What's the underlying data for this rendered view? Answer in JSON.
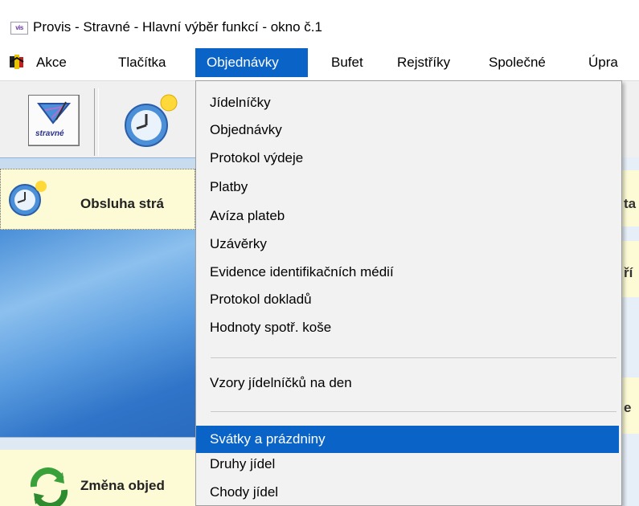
{
  "window": {
    "title": "Provis - Stravné - Hlavní výběr funkcí - okno č.1",
    "icon_text": "vis"
  },
  "menubar": {
    "items": [
      {
        "label": "Akce"
      },
      {
        "label": "Tlačítka"
      },
      {
        "label": "Objednávky"
      },
      {
        "label": "Bufet"
      },
      {
        "label": "Rejstříky"
      },
      {
        "label": "Společné"
      },
      {
        "label": "Úpra"
      }
    ],
    "active_index": 2
  },
  "toolbar": {
    "stravne_label": "stravné"
  },
  "panels": {
    "obsluha": "Obsluha strá",
    "zmena": "Změna objed",
    "right_a": "ta",
    "right_b": "ří",
    "right_c": "e"
  },
  "dropdown": {
    "items": [
      {
        "label": "Jídelníčky"
      },
      {
        "label": "Objednávky"
      },
      {
        "label": "Protokol výdeje"
      },
      {
        "label": "Platby"
      },
      {
        "label": "Avíza plateb"
      },
      {
        "label": "Uzávěrky"
      },
      {
        "label": "Evidence identifikačních médií"
      },
      {
        "label": "Protokol dokladů"
      },
      {
        "label": "Hodnoty spotř. koše"
      },
      {
        "label": "Vzory jídelníčků na den"
      },
      {
        "label": "Svátky a prázdniny"
      },
      {
        "label": "Druhy jídel"
      },
      {
        "label": "Chody jídel"
      }
    ],
    "highlighted_index": 10
  },
  "colors": {
    "accent": "#0a64c8",
    "panel_yellow": "#fdfbd5",
    "panel_blue": "#4a8fd8"
  }
}
